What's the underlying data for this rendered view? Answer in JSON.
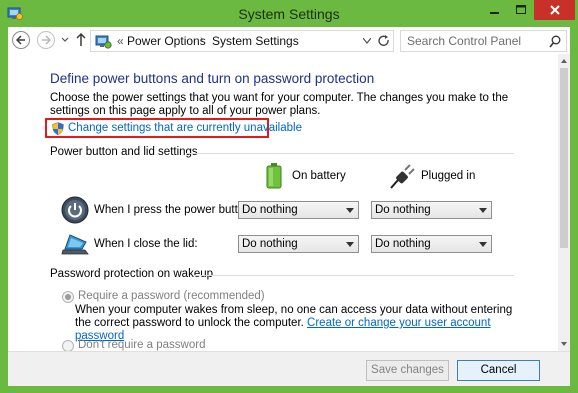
{
  "window": {
    "title": "System Settings"
  },
  "navigation": {
    "breadcrumb_prefix": "«",
    "breadcrumb": [
      "Power Options",
      "System Settings"
    ],
    "breadcrumb_separator": "›",
    "search_placeholder": "Search Control Panel"
  },
  "main": {
    "title": "Define power buttons and turn on password protection",
    "intro": "Choose the power settings that you want for your computer. The changes you make to the settings on this page apply to all of your power plans.",
    "change_link": "Change settings that are currently unavailable",
    "power_section": {
      "title": "Power button and lid settings",
      "columns": {
        "battery": "On battery",
        "plugged": "Plugged in"
      },
      "rows": [
        {
          "label": "When I press the power button:",
          "battery": "Do nothing",
          "plugged": "Do nothing"
        },
        {
          "label": "When I close the lid:",
          "battery": "Do nothing",
          "plugged": "Do nothing"
        }
      ]
    },
    "password_section": {
      "title": "Password protection on wakeup",
      "require_label": "Require a password (recommended)",
      "require_desc": "When your computer wakes from sleep, no one can access your data without entering the correct password to unlock the computer.",
      "create_link": "Create or change your user account password",
      "no_require_label": "Don't require a password"
    }
  },
  "footer": {
    "save_label": "Save changes",
    "cancel_label": "Cancel"
  },
  "colors": {
    "title_bar": "#6bb940",
    "close_button": "#c7312a",
    "heading_text": "#1e3287",
    "link": "#0066cc",
    "highlight_box": "#e01b1b"
  }
}
